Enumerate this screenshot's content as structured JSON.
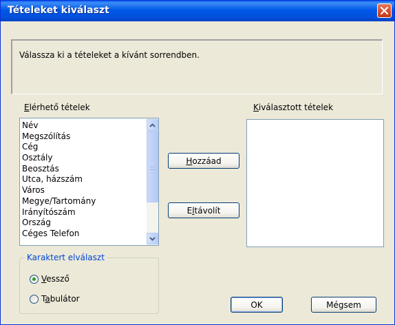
{
  "window": {
    "title": "Tételeket kiválaszt",
    "close_icon": "close-icon",
    "accent": "#0058E6",
    "close_color": "#D6492A"
  },
  "instruction": "Válassza ki a tételeket a kívánt sorrendben.",
  "available": {
    "label_accel": "E",
    "label_rest": "lérhető tételek",
    "items": [
      "Név",
      "Megszólítás",
      "Cég",
      "Osztály",
      "Beosztás",
      "Utca, házszám",
      "Város",
      "Megye/Tartomány",
      "Irányítószám",
      "Ország",
      "Céges Telefon"
    ]
  },
  "selected": {
    "label_accel": "K",
    "label_rest": "iválasztott tételek",
    "items": []
  },
  "buttons": {
    "add_accel": "H",
    "add_rest": "ozzáad",
    "remove_accel": "E",
    "remove_mid": "l",
    "remove_rest": "távolít",
    "ok": "OK",
    "cancel": "Mégsem"
  },
  "separator": {
    "legend": "Karaktert elválaszt",
    "options": [
      {
        "accel": "V",
        "rest": "essző",
        "selected": true
      },
      {
        "pre": "T",
        "accel": "a",
        "rest": "bulátor",
        "selected": false
      }
    ]
  }
}
